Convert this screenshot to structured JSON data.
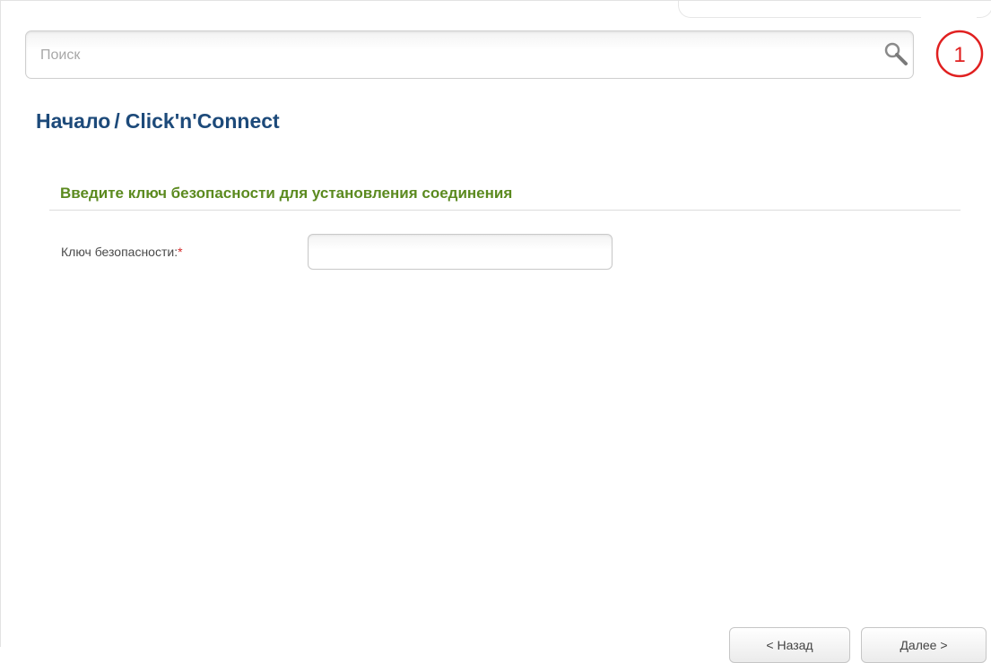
{
  "search": {
    "placeholder": "Поиск",
    "value": ""
  },
  "notifications": {
    "count": "1",
    "color": "#e02020"
  },
  "breadcrumb": {
    "home": "Начало",
    "separator": "/",
    "current": "Click'n'Connect"
  },
  "section": {
    "title": "Введите ключ безопасности для установления соединения"
  },
  "form": {
    "security_key_label": "Ключ безопасности:",
    "required_mark": "*",
    "security_key_value": ""
  },
  "buttons": {
    "back": "< Назад",
    "next": "Далее >"
  },
  "colors": {
    "breadcrumb": "#1d4a7a",
    "section_title": "#5b8a1f",
    "required": "#d42a2a"
  },
  "icons": {
    "search": "search-icon",
    "notification": "notification-badge-icon"
  }
}
